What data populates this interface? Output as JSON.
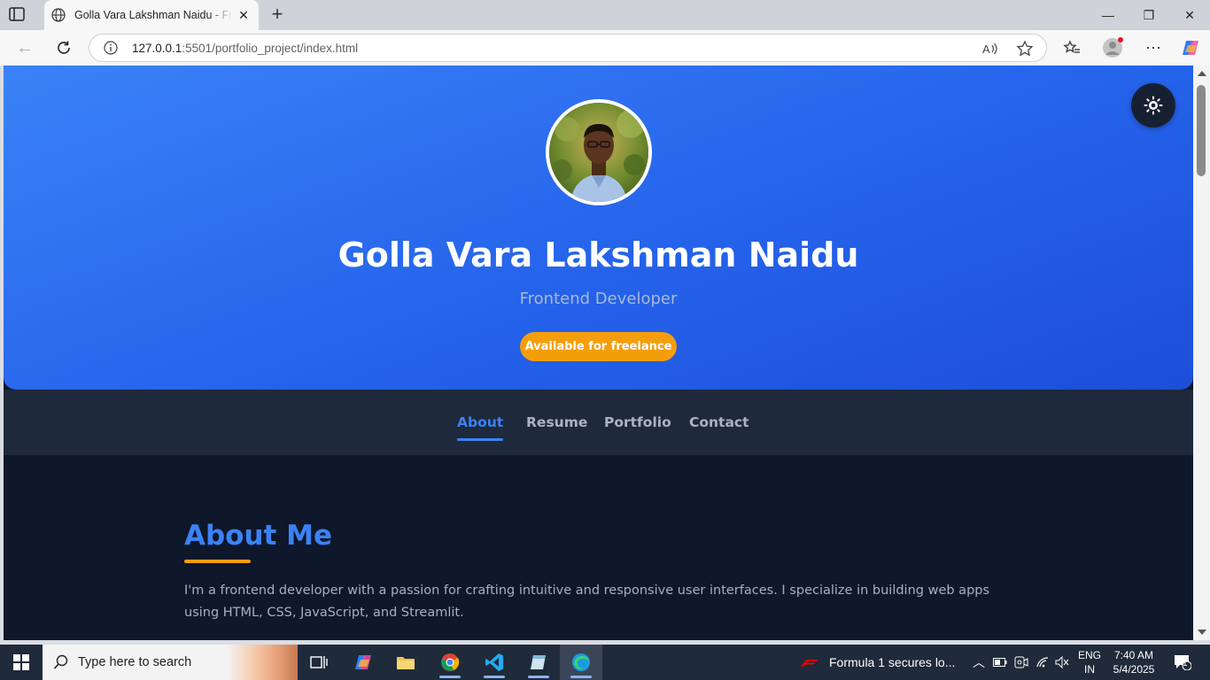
{
  "browser": {
    "tab_title": "Golla Vara Lakshman Naidu - Frontend Developer Portfolio",
    "url_host": "127.0.0.1",
    "url_rest": ":5501/portfolio_project/index.html"
  },
  "hero": {
    "name": "Golla Vara Lakshman Naidu",
    "role": "Frontend Developer",
    "badge": "Available for freelance"
  },
  "nav": {
    "items": [
      {
        "label": "About"
      },
      {
        "label": "Resume"
      },
      {
        "label": "Portfolio"
      },
      {
        "label": "Contact"
      }
    ],
    "active": "About"
  },
  "about": {
    "title": "About Me",
    "text": "I'm a frontend developer with a passion for crafting intuitive and responsive user interfaces. I specialize in building web apps using HTML, CSS, JavaScript, and Streamlit."
  },
  "taskbar": {
    "search_placeholder": "Type here to search",
    "news": "Formula 1 secures lo...",
    "lang_line1": "ENG",
    "lang_line2": "IN",
    "time": "7:40 AM",
    "date": "5/4/2025",
    "notification_count": "1"
  },
  "colors": {
    "accent": "#3b82f6",
    "badge": "#f59e0b",
    "page_bg": "#0f172a",
    "nav_bg": "#1e293b"
  }
}
